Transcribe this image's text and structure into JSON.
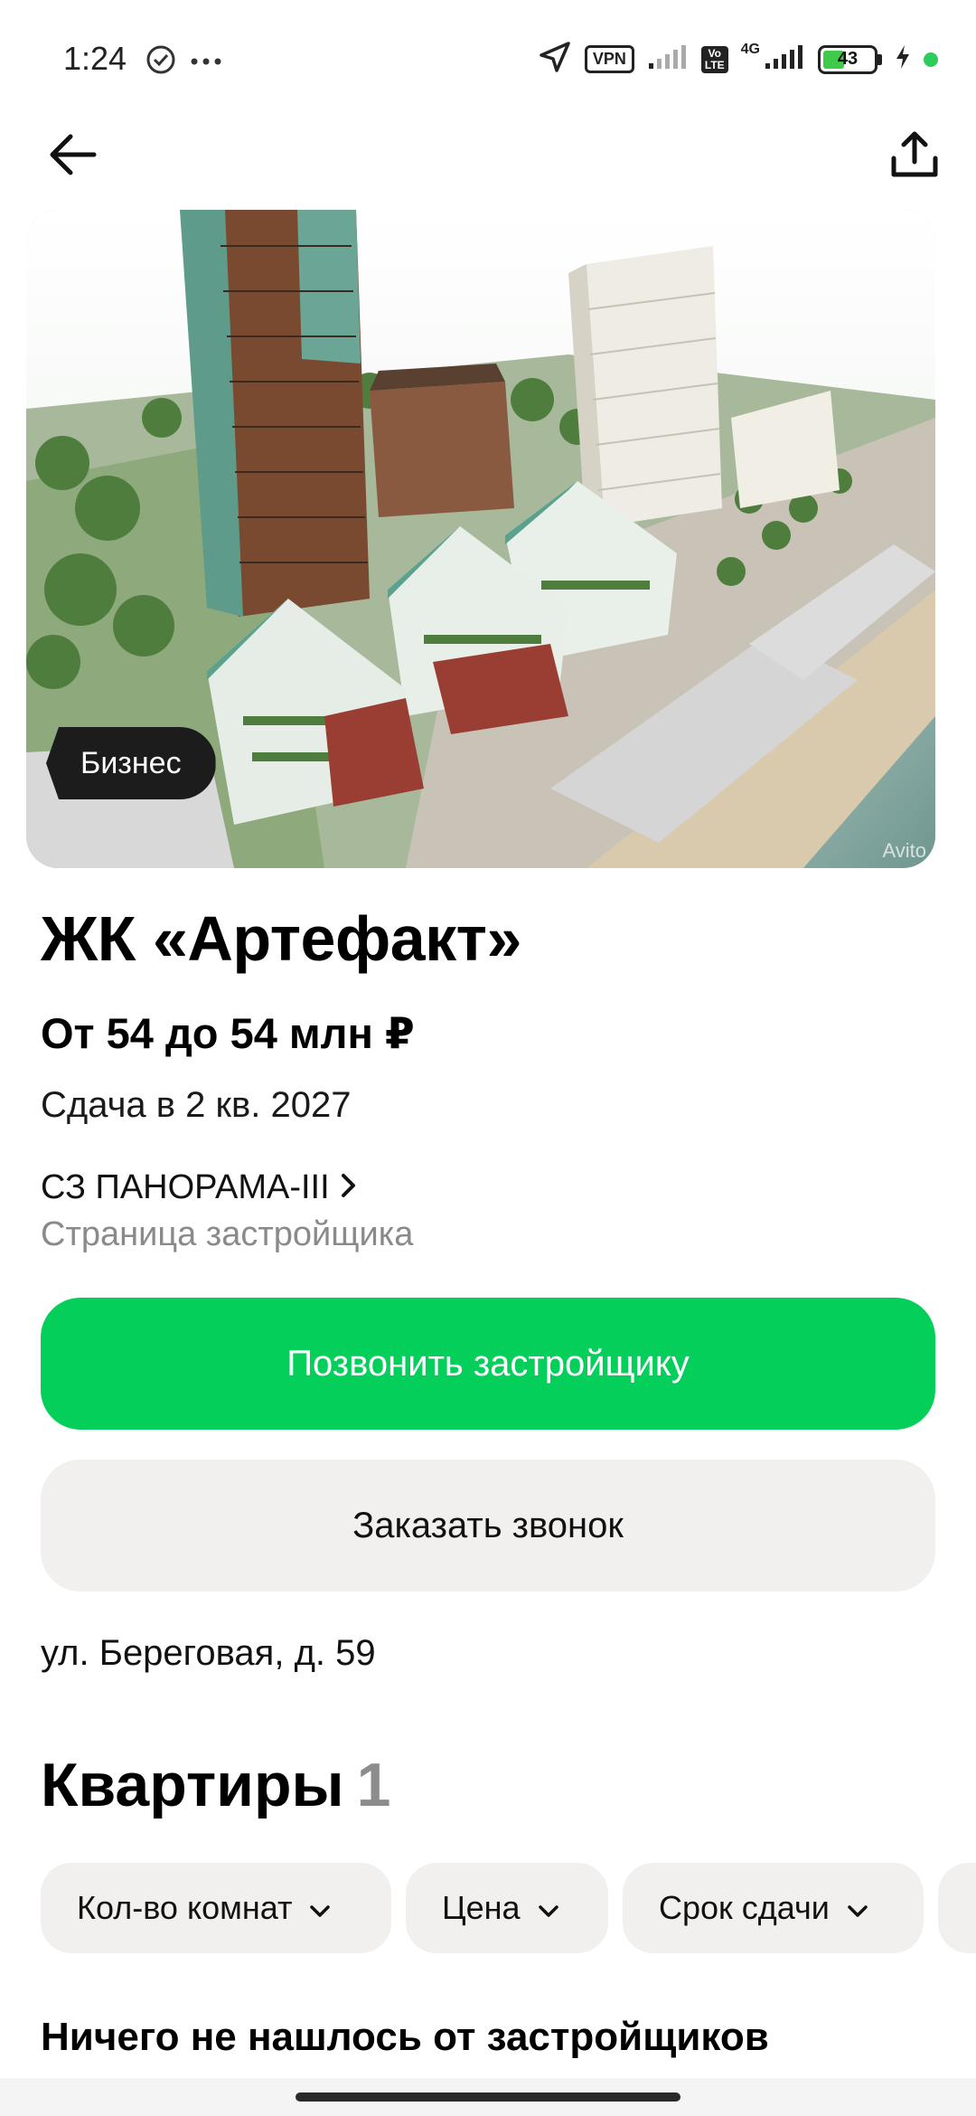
{
  "status_bar": {
    "time": "1:24",
    "vpn": "VPN",
    "volte": "Vo LTE",
    "network": "4G",
    "battery": "43",
    "battery_level": 0.43
  },
  "hero": {
    "badge": "Бизнес",
    "watermark": "Avito"
  },
  "listing": {
    "title": "ЖК «Артефакт»",
    "price": "От 54 до 54 млн ₽",
    "delivery": "Сдача в 2 кв. 2027",
    "developer_name": "СЗ ПАНОРАМА-III",
    "developer_link": "Страница застройщика",
    "address": "ул. Береговая, д. 59"
  },
  "actions": {
    "call_label": "Позвонить застройщику",
    "callback_label": "Заказать звонок"
  },
  "apartments": {
    "title": "Квартиры",
    "count": "1",
    "filters": [
      "Кол-во комнат",
      "Цена",
      "Срок сдачи"
    ],
    "empty_message": "Ничего не нашлось от застройщиков"
  },
  "colors": {
    "accent_green": "#04cf5b",
    "chip_bg": "#f1f0ef",
    "muted_text": "#8a8a8a"
  },
  "icons": [
    "back-arrow-icon",
    "share-icon",
    "chevron-right-icon",
    "chevron-down-icon",
    "location-arrow-icon",
    "signal-icon"
  ]
}
